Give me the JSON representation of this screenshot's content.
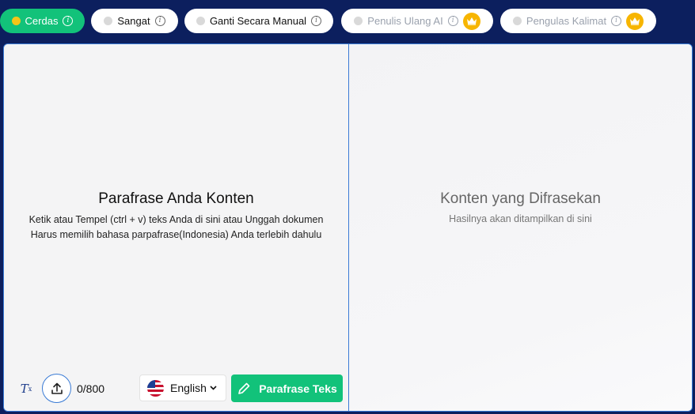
{
  "modes": [
    {
      "label": "Cerdas",
      "state": "active",
      "premium": false
    },
    {
      "label": "Sangat",
      "state": "normal",
      "premium": false
    },
    {
      "label": "Ganti Secara Manual",
      "state": "normal",
      "premium": false
    },
    {
      "label": "Penulis Ulang AI",
      "state": "disabled",
      "premium": true
    },
    {
      "label": "Pengulas Kalimat",
      "state": "disabled",
      "premium": true
    }
  ],
  "info_glyph": "i",
  "input_panel": {
    "title": "Parafrase Anda Konten",
    "line1": "Ketik atau Tempel (ctrl + v) teks Anda di sini atau Unggah dokumen",
    "line2": "Harus memilih bahasa parpafrase(Indonesia) Anda terlebih dahulu"
  },
  "output_panel": {
    "title": "Konten yang Difrasekan",
    "subtitle": "Hasilnya akan ditampilkan di sini"
  },
  "toolbar": {
    "clear_glyph": "T",
    "clear_sub": "x",
    "counter": "0/800",
    "language": "English",
    "language_flag": "us-flag-icon",
    "paraphrase_label": "Parafrase Teks"
  },
  "colors": {
    "header_bg": "#0c1f5e",
    "accent_green": "#12c27a",
    "border_blue": "#3a7bd5",
    "crown_gold": "#f7b500",
    "active_dot": "#f5c518"
  }
}
